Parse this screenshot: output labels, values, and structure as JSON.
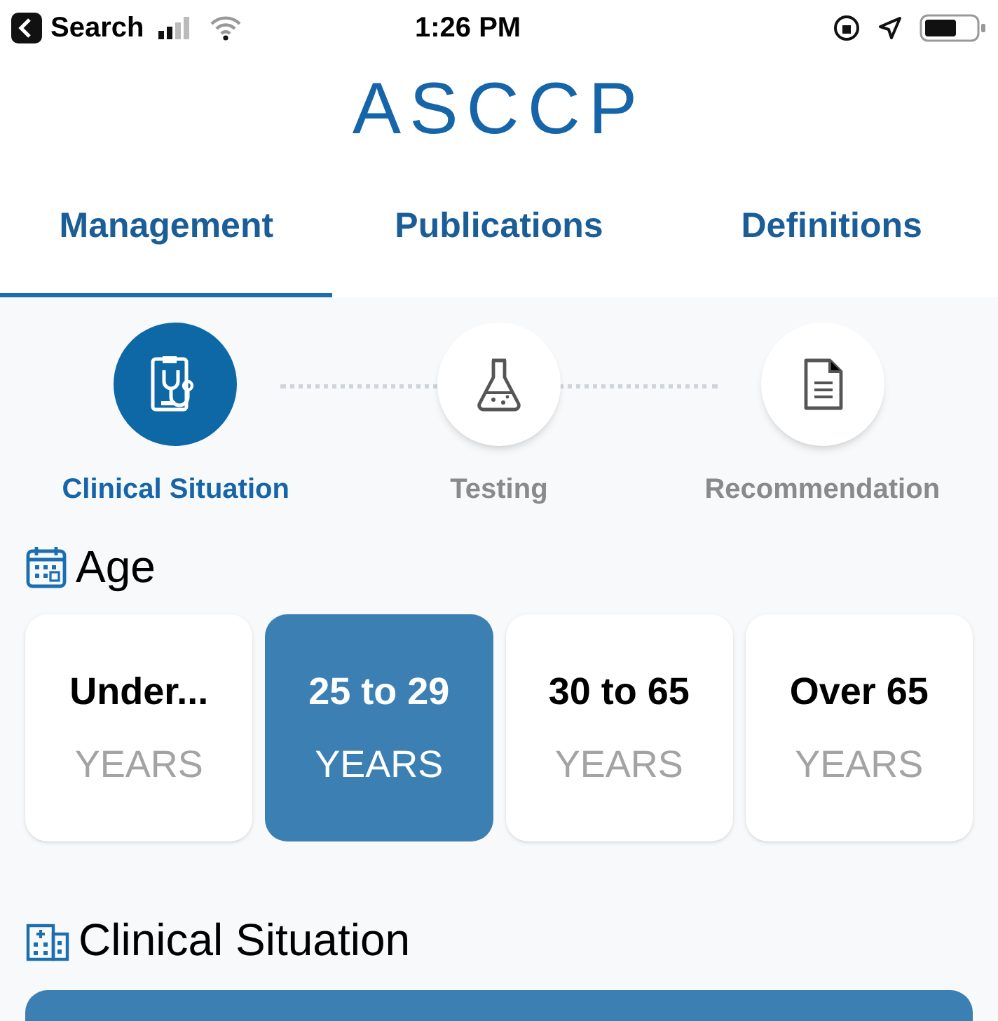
{
  "status_bar": {
    "back_label": "Search",
    "time": "1:26 PM"
  },
  "logo": {
    "text": "ASCCP"
  },
  "tabs": [
    {
      "label": "Management",
      "selected": true
    },
    {
      "label": "Publications",
      "selected": false
    },
    {
      "label": "Definitions",
      "selected": false
    }
  ],
  "steps": [
    {
      "label": "Clinical Situation",
      "kind": "clinical",
      "selected": true
    },
    {
      "label": "Testing",
      "kind": "testing",
      "selected": false
    },
    {
      "label": "Recommendation",
      "kind": "document",
      "selected": false
    }
  ],
  "age": {
    "title": "Age",
    "options": [
      {
        "value": "Under...",
        "unit": "YEARS",
        "selected": false
      },
      {
        "value": "25 to 29",
        "unit": "YEARS",
        "selected": true
      },
      {
        "value": "30 to 65",
        "unit": "YEARS",
        "selected": false
      },
      {
        "value": "Over 65",
        "unit": "YEARS",
        "selected": false
      }
    ]
  },
  "clinical_situation": {
    "title": "Clinical Situation"
  }
}
